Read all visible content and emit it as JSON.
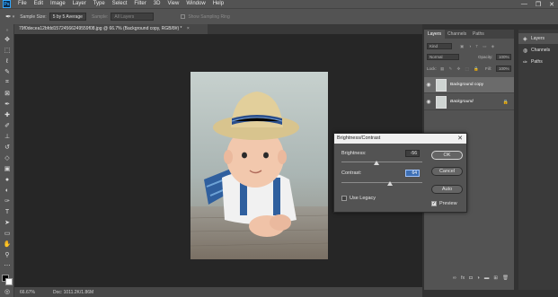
{
  "menubar": {
    "logo": "Ps",
    "items": [
      "File",
      "Edit",
      "Image",
      "Layer",
      "Type",
      "Select",
      "Filter",
      "3D",
      "View",
      "Window",
      "Help"
    ],
    "window_controls": [
      "—",
      "❐",
      "✕"
    ]
  },
  "options_bar": {
    "sample_size_label": "Sample Size:",
    "sample_size_value": "5 by 5 Average",
    "sample_label": "Sample:",
    "sample_value": "All Layers",
    "show_ring_label": "Show Sampling Ring"
  },
  "document": {
    "tab_title": "79f0decea12bfdd15724566249559f08.jpg @ 66.7% (Background copy, RGB/8#) *",
    "tab_close": "×"
  },
  "status_bar": {
    "zoom": "66.67%",
    "doc_info": "Doc: 1011.2K/1.86M"
  },
  "layers_panel": {
    "tabs": [
      "Layers",
      "Channels",
      "Paths"
    ],
    "kind_filter": "Kind",
    "blend_mode": "Normal",
    "opacity_label": "Opacity:",
    "opacity_value": "100%",
    "lock_label": "Lock:",
    "fill_label": "Fill:",
    "fill_value": "100%",
    "layers": [
      {
        "name": "Background copy",
        "selected": true
      },
      {
        "name": "Background",
        "selected": false
      }
    ],
    "footer_icons": [
      "link-icon",
      "fx-icon",
      "mask-icon",
      "adjustment-icon",
      "folder-icon",
      "new-layer-icon",
      "trash-icon"
    ]
  },
  "right_dock": {
    "items": [
      "Layers",
      "Channels",
      "Paths"
    ]
  },
  "dialog": {
    "title": "Brightness/Contrast",
    "brightness_label": "Brightness:",
    "brightness_value": "-56",
    "brightness_fraction": 0.43,
    "contrast_label": "Contrast:",
    "contrast_value": "64",
    "contrast_fraction": 0.6,
    "use_legacy_label": "Use Legacy",
    "use_legacy_checked": false,
    "ok_label": "OK",
    "cancel_label": "Cancel",
    "auto_label": "Auto",
    "preview_label": "Preview",
    "preview_checked": true
  },
  "colors": {
    "accent": "#31a8ff",
    "panel_bg": "#535353",
    "canvas_bg": "#262626"
  }
}
